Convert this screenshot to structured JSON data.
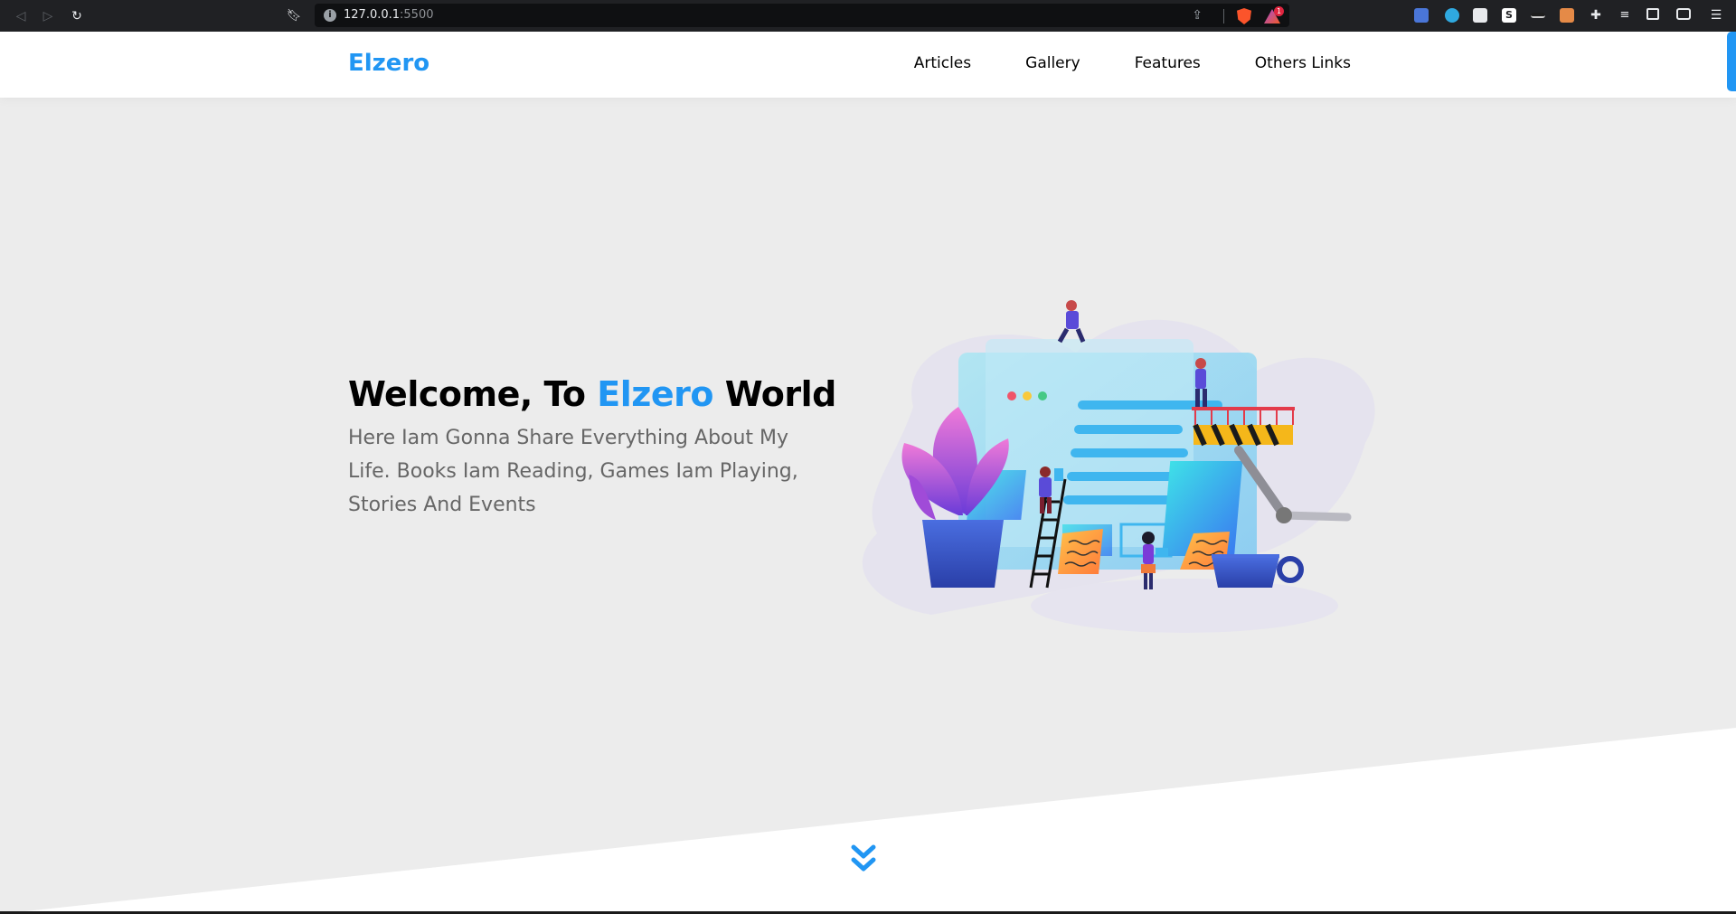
{
  "browser": {
    "url_host": "127.0.0.1",
    "url_port": ":5500",
    "rewards_badge": "1",
    "icons": [
      "back-icon",
      "forward-icon",
      "reload-icon",
      "bookmark-icon",
      "site-info-icon",
      "share-icon",
      "brave-shield-icon",
      "brave-rewards-icon",
      "extensions-icon",
      "menu-icon"
    ]
  },
  "header": {
    "logo": "Elzero",
    "nav": [
      "Articles",
      "Gallery",
      "Features",
      "Others Links"
    ]
  },
  "landing": {
    "title_prefix": "Welcome, To ",
    "title_brand": "Elzero",
    "title_suffix": " World",
    "subtitle": "Here Iam Gonna Share Everything About My Life. Books Iam Reading, Games Iam Playing, Stories And Events"
  },
  "colors": {
    "brand": "#2196f3",
    "section_bg": "#ececec",
    "header_bg": "#ffffff"
  },
  "down_icon": "double-chevron-down-icon"
}
